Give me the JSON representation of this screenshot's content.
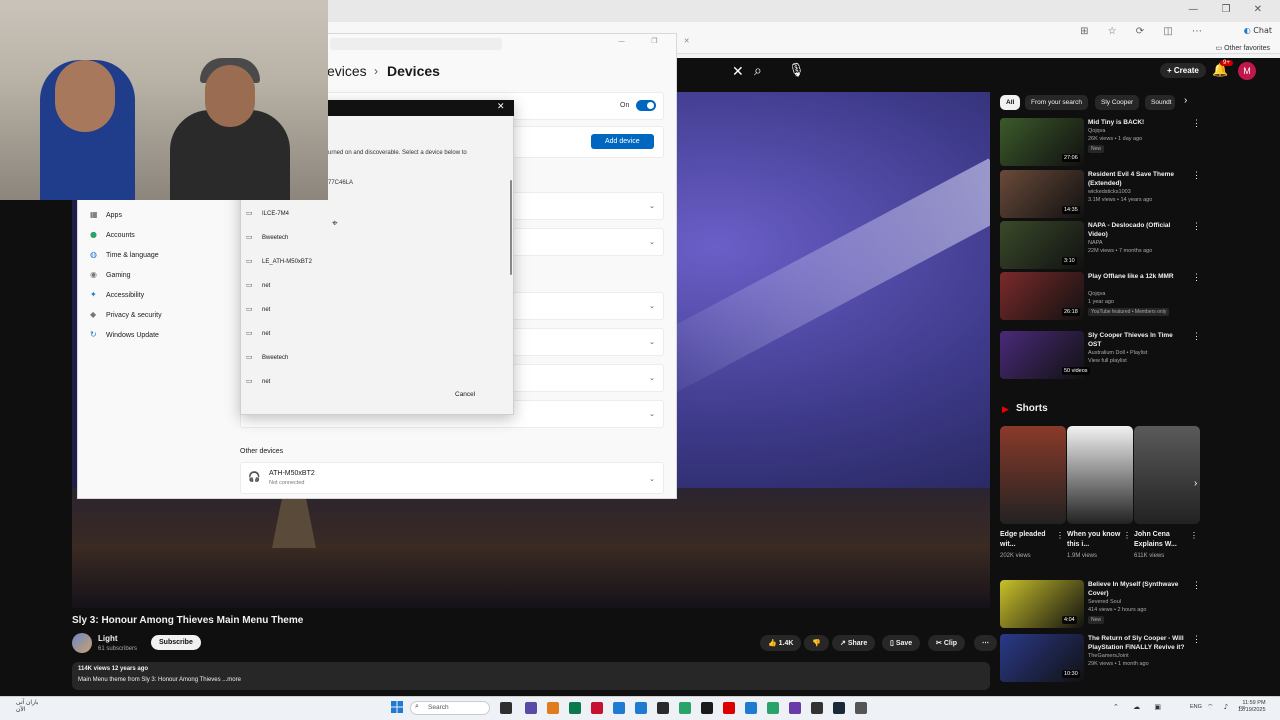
{
  "browser": {
    "other_favorites": "Other favorites",
    "copilot_label": "Chat",
    "window_controls": "— ❐ ✕"
  },
  "youtube": {
    "create_label": "Create",
    "notification_count": "9+",
    "avatar_letter": "M",
    "chips": [
      "All",
      "From your search",
      "Sly Cooper",
      "Soundt"
    ],
    "video": {
      "title": "Sly 3: Honour Among Thieves Main Menu Theme",
      "channel": "Light",
      "subscribers": "61 subscribers",
      "subscribe_label": "Subscribe",
      "likes": "1.4K",
      "share_label": "Share",
      "save_label": "Save",
      "clip_label": "Clip",
      "meta": "114K views  12 years ago",
      "description": "Main Menu theme from Sly 3: Honour Among Thieves ...more"
    },
    "recommendations": [
      {
        "title": "Mid Tiny is BACK!",
        "channel": "Qojqva",
        "meta": "26K views • 1 day ago",
        "badge": "New",
        "duration": "27:06",
        "color": "#3b5a2a"
      },
      {
        "title": "Resident Evil 4 Save Theme (Extended)",
        "channel": "wickedsticks1003",
        "meta": "3.1M views • 14 years ago",
        "badge": "",
        "duration": "14:35",
        "color": "#6a4a3a"
      },
      {
        "title": "NAPA - Deslocado (Official Video)",
        "channel": "NAPA",
        "meta": "22M views • 7 months ago",
        "badge": "",
        "duration": "3:10",
        "color": "#3a4a2a"
      },
      {
        "title": "Play Offlane like a 12k MMR",
        "channel": "Qojqva",
        "meta": "1 year ago",
        "badge": "YouTube featured  • Members only",
        "duration": "26:18",
        "color": "#7a2a2a"
      },
      {
        "title": "Sly Cooper Thieves In Time OST",
        "channel": "Australium Doll • Playlist",
        "meta": "View full playlist",
        "badge": "",
        "duration": "50 videos",
        "color": "#4a2a7a"
      }
    ],
    "shorts_title": "Shorts",
    "shorts": [
      {
        "title": "Edge pleaded wit...",
        "views": "202K views",
        "color": "#8a3a2a"
      },
      {
        "title": "When you know this i...",
        "views": "1.9M views",
        "color": "#f2f2f2"
      },
      {
        "title": "John Cena Explains W...",
        "views": "611K views",
        "color": "#5a5a5a"
      }
    ],
    "recommendations2": [
      {
        "title": "Believe In Myself (Synthwave Cover)",
        "channel": "Severed Soul",
        "meta": "414 views • 2 hours ago",
        "badge": "New",
        "duration": "4:04",
        "color": "#c8c02a"
      },
      {
        "title": "The Return of Sly Cooper - Will PlayStation FINALLY Revive it?",
        "channel": "TheGamersJoint",
        "meta": "29K views • 1 month ago",
        "badge": "",
        "duration": "10:30",
        "color": "#2a3a8a"
      }
    ]
  },
  "settings": {
    "breadcrumb_parent": "evices",
    "breadcrumb_current": "Devices",
    "toggle_label": "On",
    "add_device_label": "Add device",
    "nav": [
      {
        "label": "Apps",
        "icon": "▦",
        "color": "#555"
      },
      {
        "label": "Accounts",
        "icon": "●",
        "color": "#2aa36a"
      },
      {
        "label": "Time & language",
        "icon": "◍",
        "color": "#1f7ad1"
      },
      {
        "label": "Gaming",
        "icon": "◉",
        "color": "#777"
      },
      {
        "label": "Accessibility",
        "icon": "✦",
        "color": "#1f7ad1"
      },
      {
        "label": "Privacy & security",
        "icon": "◆",
        "color": "#777"
      },
      {
        "label": "Windows Update",
        "icon": "↻",
        "color": "#1f7ad1"
      }
    ],
    "other_devices_label": "Other devices",
    "other_device": {
      "name": "ATH-M50xBT2",
      "status": "Not connected"
    }
  },
  "dialog": {
    "description": "urned on and discoverable. Select a device below to",
    "first_item": "77C46LA",
    "devices": [
      "ILCE-7M4",
      "Bweetech",
      "LE_ATH-M50xBT2",
      "net",
      "net",
      "net",
      "Bweetech",
      "net"
    ],
    "cancel_label": "Cancel"
  },
  "taskbar": {
    "weather": "باران آتی\nالآن",
    "search_placeholder": "Search",
    "lang": "ENG",
    "time": "11:59 PM",
    "date": "12/19/2025"
  }
}
